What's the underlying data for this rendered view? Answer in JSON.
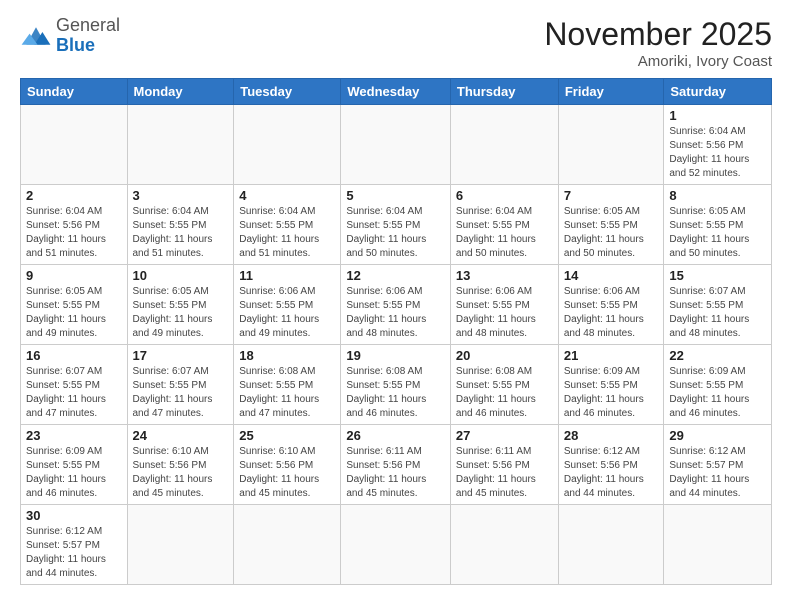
{
  "logo": {
    "general": "General",
    "blue": "Blue"
  },
  "header": {
    "title": "November 2025",
    "location": "Amoriki, Ivory Coast"
  },
  "weekdays": [
    "Sunday",
    "Monday",
    "Tuesday",
    "Wednesday",
    "Thursday",
    "Friday",
    "Saturday"
  ],
  "weeks": [
    [
      {
        "day": "",
        "info": ""
      },
      {
        "day": "",
        "info": ""
      },
      {
        "day": "",
        "info": ""
      },
      {
        "day": "",
        "info": ""
      },
      {
        "day": "",
        "info": ""
      },
      {
        "day": "",
        "info": ""
      },
      {
        "day": "1",
        "info": "Sunrise: 6:04 AM\nSunset: 5:56 PM\nDaylight: 11 hours\nand 52 minutes."
      }
    ],
    [
      {
        "day": "2",
        "info": "Sunrise: 6:04 AM\nSunset: 5:56 PM\nDaylight: 11 hours\nand 51 minutes."
      },
      {
        "day": "3",
        "info": "Sunrise: 6:04 AM\nSunset: 5:55 PM\nDaylight: 11 hours\nand 51 minutes."
      },
      {
        "day": "4",
        "info": "Sunrise: 6:04 AM\nSunset: 5:55 PM\nDaylight: 11 hours\nand 51 minutes."
      },
      {
        "day": "5",
        "info": "Sunrise: 6:04 AM\nSunset: 5:55 PM\nDaylight: 11 hours\nand 50 minutes."
      },
      {
        "day": "6",
        "info": "Sunrise: 6:04 AM\nSunset: 5:55 PM\nDaylight: 11 hours\nand 50 minutes."
      },
      {
        "day": "7",
        "info": "Sunrise: 6:05 AM\nSunset: 5:55 PM\nDaylight: 11 hours\nand 50 minutes."
      },
      {
        "day": "8",
        "info": "Sunrise: 6:05 AM\nSunset: 5:55 PM\nDaylight: 11 hours\nand 50 minutes."
      }
    ],
    [
      {
        "day": "9",
        "info": "Sunrise: 6:05 AM\nSunset: 5:55 PM\nDaylight: 11 hours\nand 49 minutes."
      },
      {
        "day": "10",
        "info": "Sunrise: 6:05 AM\nSunset: 5:55 PM\nDaylight: 11 hours\nand 49 minutes."
      },
      {
        "day": "11",
        "info": "Sunrise: 6:06 AM\nSunset: 5:55 PM\nDaylight: 11 hours\nand 49 minutes."
      },
      {
        "day": "12",
        "info": "Sunrise: 6:06 AM\nSunset: 5:55 PM\nDaylight: 11 hours\nand 48 minutes."
      },
      {
        "day": "13",
        "info": "Sunrise: 6:06 AM\nSunset: 5:55 PM\nDaylight: 11 hours\nand 48 minutes."
      },
      {
        "day": "14",
        "info": "Sunrise: 6:06 AM\nSunset: 5:55 PM\nDaylight: 11 hours\nand 48 minutes."
      },
      {
        "day": "15",
        "info": "Sunrise: 6:07 AM\nSunset: 5:55 PM\nDaylight: 11 hours\nand 48 minutes."
      }
    ],
    [
      {
        "day": "16",
        "info": "Sunrise: 6:07 AM\nSunset: 5:55 PM\nDaylight: 11 hours\nand 47 minutes."
      },
      {
        "day": "17",
        "info": "Sunrise: 6:07 AM\nSunset: 5:55 PM\nDaylight: 11 hours\nand 47 minutes."
      },
      {
        "day": "18",
        "info": "Sunrise: 6:08 AM\nSunset: 5:55 PM\nDaylight: 11 hours\nand 47 minutes."
      },
      {
        "day": "19",
        "info": "Sunrise: 6:08 AM\nSunset: 5:55 PM\nDaylight: 11 hours\nand 46 minutes."
      },
      {
        "day": "20",
        "info": "Sunrise: 6:08 AM\nSunset: 5:55 PM\nDaylight: 11 hours\nand 46 minutes."
      },
      {
        "day": "21",
        "info": "Sunrise: 6:09 AM\nSunset: 5:55 PM\nDaylight: 11 hours\nand 46 minutes."
      },
      {
        "day": "22",
        "info": "Sunrise: 6:09 AM\nSunset: 5:55 PM\nDaylight: 11 hours\nand 46 minutes."
      }
    ],
    [
      {
        "day": "23",
        "info": "Sunrise: 6:09 AM\nSunset: 5:55 PM\nDaylight: 11 hours\nand 46 minutes."
      },
      {
        "day": "24",
        "info": "Sunrise: 6:10 AM\nSunset: 5:56 PM\nDaylight: 11 hours\nand 45 minutes."
      },
      {
        "day": "25",
        "info": "Sunrise: 6:10 AM\nSunset: 5:56 PM\nDaylight: 11 hours\nand 45 minutes."
      },
      {
        "day": "26",
        "info": "Sunrise: 6:11 AM\nSunset: 5:56 PM\nDaylight: 11 hours\nand 45 minutes."
      },
      {
        "day": "27",
        "info": "Sunrise: 6:11 AM\nSunset: 5:56 PM\nDaylight: 11 hours\nand 45 minutes."
      },
      {
        "day": "28",
        "info": "Sunrise: 6:12 AM\nSunset: 5:56 PM\nDaylight: 11 hours\nand 44 minutes."
      },
      {
        "day": "29",
        "info": "Sunrise: 6:12 AM\nSunset: 5:57 PM\nDaylight: 11 hours\nand 44 minutes."
      }
    ],
    [
      {
        "day": "30",
        "info": "Sunrise: 6:12 AM\nSunset: 5:57 PM\nDaylight: 11 hours\nand 44 minutes."
      },
      {
        "day": "",
        "info": ""
      },
      {
        "day": "",
        "info": ""
      },
      {
        "day": "",
        "info": ""
      },
      {
        "day": "",
        "info": ""
      },
      {
        "day": "",
        "info": ""
      },
      {
        "day": "",
        "info": ""
      }
    ]
  ]
}
